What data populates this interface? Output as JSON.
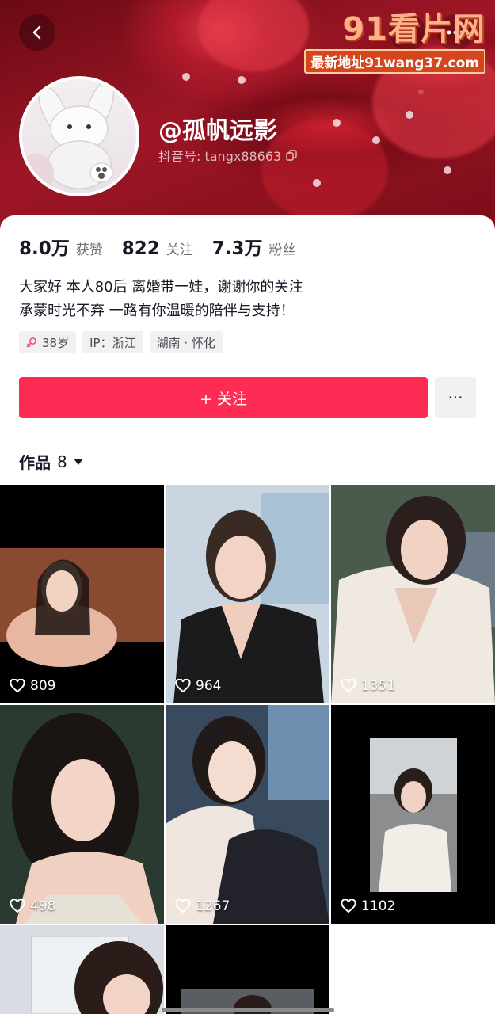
{
  "nav": {
    "back_icon": "chevron-left-icon",
    "search_icon": "search-icon",
    "more_icon": "more-horizontal-icon"
  },
  "watermark": {
    "logo": "91看片网",
    "url": "最新地址91wang37.com"
  },
  "profile": {
    "nickname": "@孤帆远影",
    "account_label": "抖音号: tangx88663",
    "copy_icon": "copy-icon"
  },
  "stats": [
    {
      "value": "8.0万",
      "label": "获赞"
    },
    {
      "value": "822",
      "label": "关注"
    },
    {
      "value": "7.3万",
      "label": "粉丝"
    }
  ],
  "bio": {
    "line1": "大家好 本人80后 离婚带一娃，谢谢你的关注",
    "line2": "承蒙时光不弃 一路有你温暖的陪伴与支持！"
  },
  "tags": [
    {
      "label": "38岁",
      "icon": "female-icon"
    },
    {
      "label": "IP：浙江",
      "icon": ""
    },
    {
      "label": "湖南 · 怀化",
      "icon": ""
    }
  ],
  "actions": {
    "follow_label": "+ 关注",
    "more_label": "···"
  },
  "works": {
    "tab_label": "作品",
    "count": "8",
    "dropdown_icon": "caret-down-icon"
  },
  "videos": [
    {
      "likes": "809"
    },
    {
      "likes": "964"
    },
    {
      "likes": "1351"
    },
    {
      "likes": "498"
    },
    {
      "likes": "1267"
    },
    {
      "likes": "1102"
    },
    {
      "likes": ""
    },
    {
      "likes": ""
    }
  ],
  "colors": {
    "accent": "#fe2c55",
    "banner": "#9e1626",
    "watermark": "#ffb08a"
  }
}
